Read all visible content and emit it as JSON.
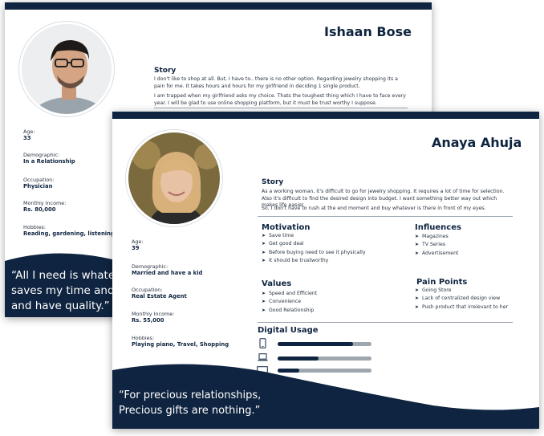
{
  "persona_back": {
    "name": "Ishaan Bose",
    "story_title": "Story",
    "story_p1": "I don't like to shop at all. But, I have to.. there is no other option. Regarding jewelry shopping its a pain for me. It takes hours and hours for my girlfriend in deciding 1 single product.",
    "story_p2": "I am trapped when my girlfriend asks my choice. Thats the toughest thing which I have to face every year. I will be glad to use online shopping platform, but it must be trust worthy I suppose.",
    "age_label": "Age:",
    "age": "33",
    "demographic_label": "Demographic:",
    "demographic": "In a Relationship",
    "occupation_label": "Occupation:",
    "occupation": "Physician",
    "income_label": "Monthly Income:",
    "income": "Rs. 80,000",
    "hobbies_label": "Hobbies:",
    "hobbies": "Reading, gardening, listening mu",
    "quote_line1": "“All I need is whateve",
    "quote_line2": "saves my time and m",
    "quote_line3": "and have quality.”"
  },
  "persona_front": {
    "name": "Anaya Ahuja",
    "story_title": "Story",
    "story_p1": "As a working woman, it's difficult to go for jewelry shopping. It requires a lot of time for selection. Also it's difficult to find the desired design into budget. I want something better  way out which makes life easier.",
    "story_p2": "So, I don't have to rush at the end moment and buy whatever is there in front of my eyes.",
    "motivation_title": "Motivation",
    "motivation": [
      "Save time",
      "Get good deal",
      "Before buying need to see it physically",
      "It should be trustworthy"
    ],
    "influences_title": "Influences",
    "influences": [
      "Magazines",
      "TV Series",
      "Advertisement"
    ],
    "values_title": "Values",
    "values": [
      "Speed and Efficient",
      "Convenience",
      "Good Relationship"
    ],
    "pain_title": "Pain Points",
    "pain_points": [
      "Going Store",
      "Lack of centralized design view",
      "Push product that irrelevant to her"
    ],
    "digital_title": "Digital Usage",
    "digital_usage": [
      {
        "device": "phone-icon",
        "level": 0.8
      },
      {
        "device": "laptop-icon",
        "level": 0.44
      },
      {
        "device": "desktop-icon",
        "level": 0.23
      }
    ],
    "age_label": "Age:",
    "age": "39",
    "demographic_label": "Demographic:",
    "demographic": "Married and have a kid",
    "occupation_label": "Occupation:",
    "occupation": "Real Estate Agent",
    "income_label": "Monthly Income:",
    "income": "Rs. 55,000",
    "hobbies_label": "Hobbies:",
    "hobbies": "Playing piano, Travel, Shopping",
    "quote_line1": "“For precious relationships,",
    "quote_line2": "Precious gifts are nothing.”"
  },
  "colors": {
    "navy": "#0f2440",
    "bar_track": "#9ea6ae"
  }
}
